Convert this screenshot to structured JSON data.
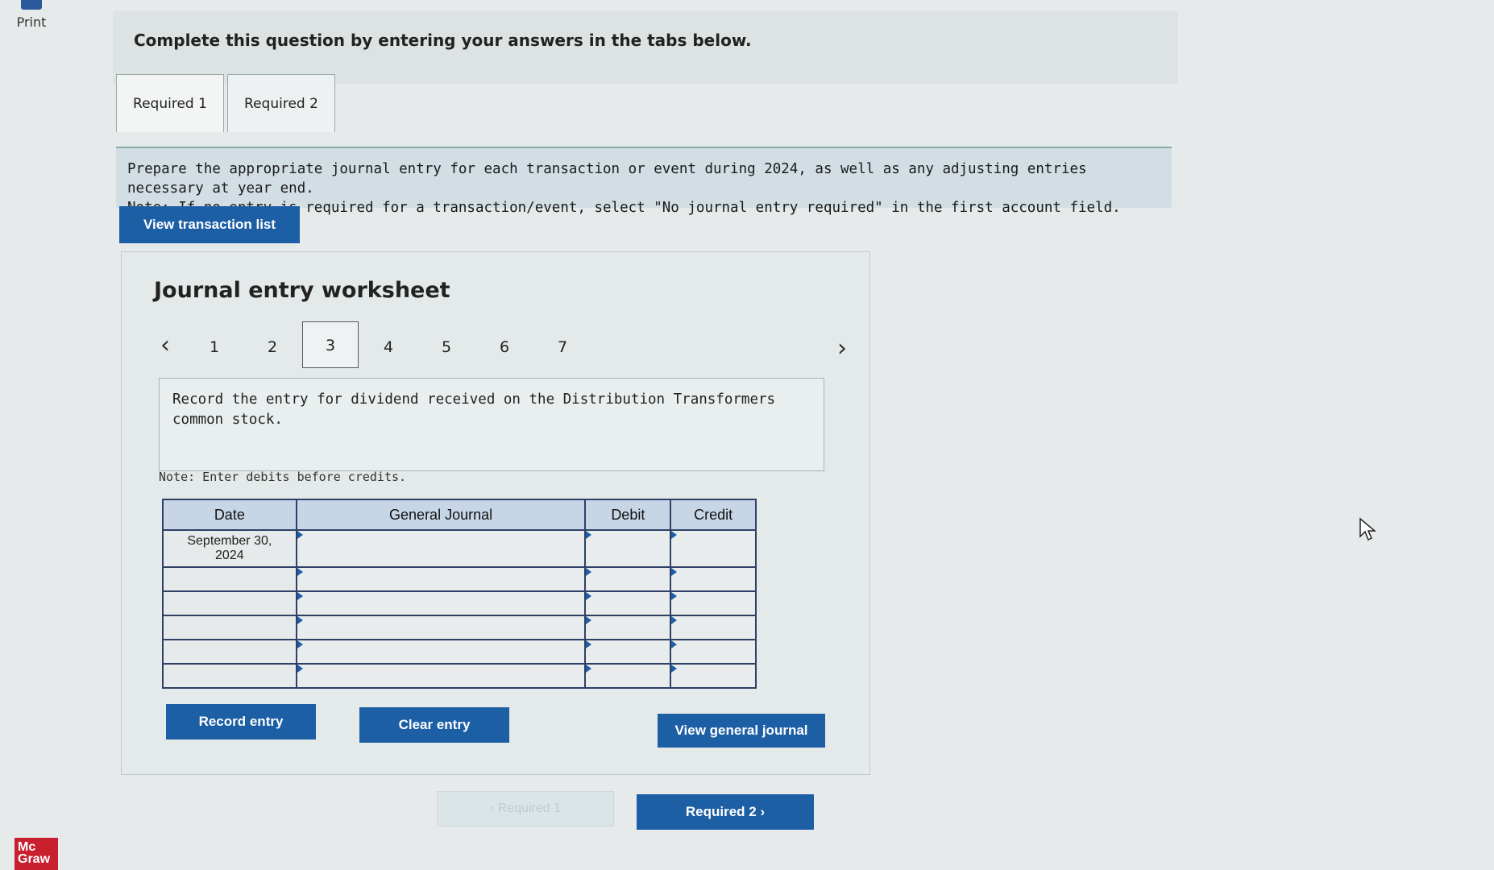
{
  "header": {
    "print_label": "Print",
    "title": "Complete this question by entering your answers in the tabs below."
  },
  "tabs": [
    {
      "label": "Required 1"
    },
    {
      "label": "Required 2"
    }
  ],
  "instructions": {
    "line1": "Prepare the appropriate journal entry for each transaction or event during 2024, as well as any adjusting entries necessary at year end.",
    "line2": "Note: If no entry is required for a transaction/event, select \"No journal entry required\" in the first account field."
  },
  "buttons": {
    "view_transaction_list": "View transaction list",
    "record_entry": "Record entry",
    "clear_entry": "Clear entry",
    "view_general_journal": "View general journal",
    "prev_required": "‹ Required 1",
    "next_required": "Required 2 ›"
  },
  "worksheet": {
    "title": "Journal entry worksheet",
    "pages": [
      "1",
      "2",
      "3",
      "4",
      "5",
      "6",
      "7"
    ],
    "active_page": "3",
    "prompt": "Record the entry for dividend received on the Distribution Transformers common stock.",
    "note": "Note: Enter debits before credits."
  },
  "journal": {
    "headers": {
      "date": "Date",
      "general_journal": "General Journal",
      "debit": "Debit",
      "credit": "Credit"
    },
    "first_date_line1": "September 30,",
    "first_date_line2": "2024"
  },
  "logo": {
    "line1": "Mc",
    "line2": "Graw"
  },
  "colors": {
    "accent": "#1d5fa5",
    "table_header": "#c7d6e7",
    "logo_red": "#c8202f"
  }
}
